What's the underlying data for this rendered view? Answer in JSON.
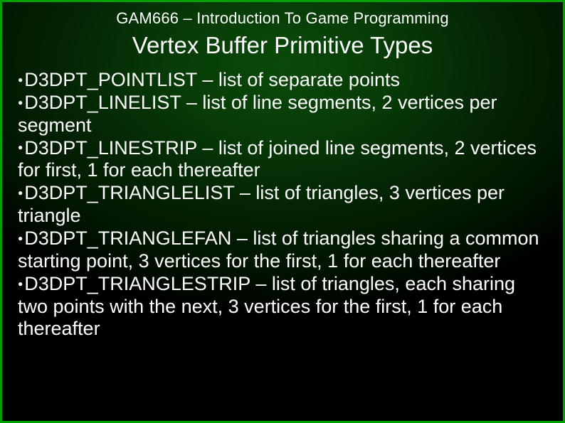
{
  "course": "GAM666 – Introduction To Game Programming",
  "title": "Vertex Buffer Primitive Types",
  "bullet": "●",
  "items": [
    "D3DPT_POINTLIST – list of separate points",
    "D3DPT_LINELIST – list of line segments, 2 vertices per segment",
    "D3DPT_LINESTRIP – list of joined line segments, 2 vertices for first, 1 for each thereafter",
    "D3DPT_TRIANGLELIST – list of triangles, 3 vertices per triangle",
    "D3DPT_TRIANGLEFAN – list of triangles sharing a common starting point, 3 vertices for the first, 1 for each thereafter",
    "D3DPT_TRIANGLESTRIP – list of triangles, each sharing two points with the next, 3 vertices for the first, 1 for each thereafter"
  ]
}
